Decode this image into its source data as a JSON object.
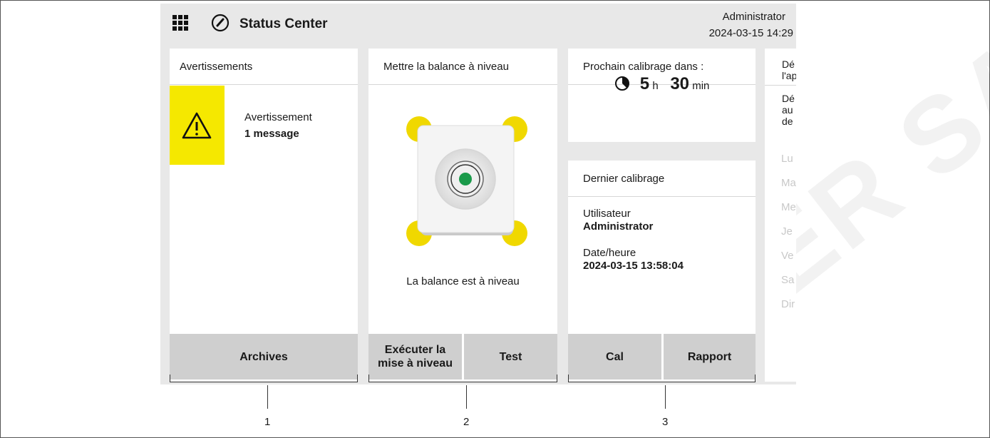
{
  "header": {
    "title": "Status Center",
    "user": "Administrator",
    "datetime": "2024-03-15 14:29"
  },
  "warnings_panel": {
    "title": "Avertissements",
    "item_title": "Avertissement",
    "item_count": "1 message",
    "archive_button": "Archives"
  },
  "level_panel": {
    "title": "Mettre la balance à niveau",
    "status": "La balance est à niveau",
    "execute_button_line1": "Exécuter la",
    "execute_button_line2": "mise à niveau",
    "test_button": "Test"
  },
  "calibration_panel": {
    "title": "Prochain calibrage dans :",
    "hours": "5",
    "hours_unit": "h",
    "minutes": "30",
    "minutes_unit": "min",
    "last_title": "Dernier calibrage",
    "user_label": "Utilisateur",
    "user_value": "Administrator",
    "date_label": "Date/heure",
    "date_value": "2024-03-15 13:58:04",
    "cal_button": "Cal",
    "report_button": "Rapport"
  },
  "schedule_panel": {
    "title_line1": "Dé",
    "title_line2": "l'ap",
    "desc_line1": "Dé",
    "desc_line2": "au",
    "desc_line3": "de",
    "days": [
      "Lu",
      "Ma",
      "Me",
      "Je",
      "Ve",
      "Sa",
      "Dir"
    ]
  },
  "annotations": {
    "n1": "1",
    "n2": "2",
    "n3": "3"
  },
  "watermark": "SHER SAS",
  "colors": {
    "warning": "#f5e800",
    "level_ok": "#1a9a4a",
    "leg": "#f0d800",
    "button": "#cfcfcf",
    "background": "#e8e8e8"
  }
}
